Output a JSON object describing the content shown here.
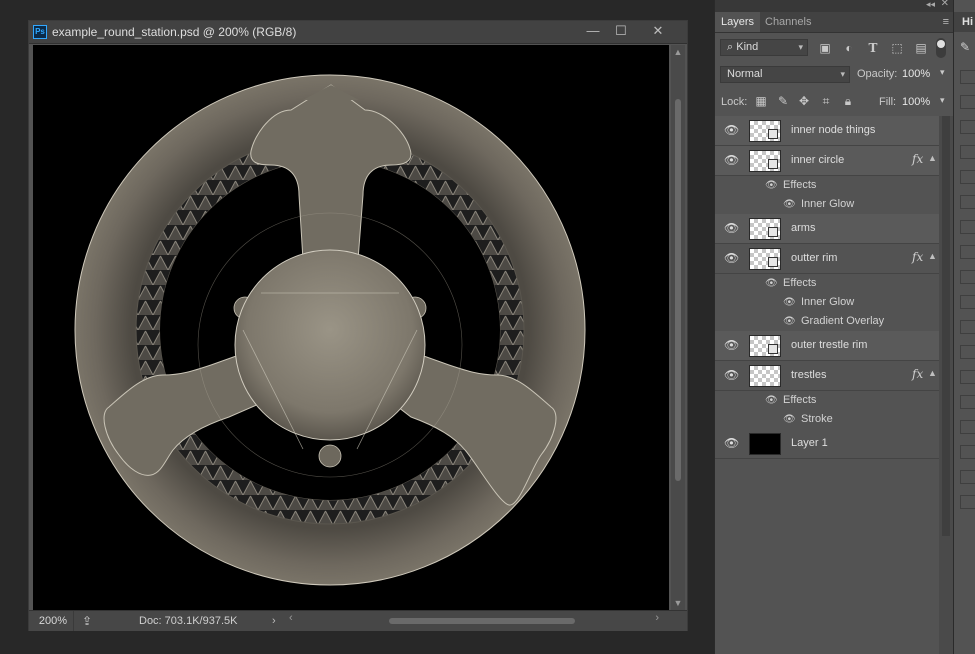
{
  "document": {
    "title": "example_round_station.psd @ 200% (RGB/8)",
    "app_icon": "Ps",
    "zoom": "200%",
    "doc_size": "Doc: 703.1K/937.5K",
    "window_controls": {
      "minimize": "—",
      "maximize": "☐",
      "close": "✕"
    }
  },
  "layers_panel": {
    "tabs": [
      "Layers",
      "Channels"
    ],
    "filter_kind": "Kind",
    "blend_mode": "Normal",
    "opacity_label": "Opacity:",
    "opacity_value": "100%",
    "lock_label": "Lock:",
    "fill_label": "Fill:",
    "fill_value": "100%",
    "fx_label": "fx",
    "effects_label": "Effects",
    "layers": [
      {
        "name": "inner node things",
        "has_fx": false,
        "thumb": "transparent"
      },
      {
        "name": "inner circle",
        "has_fx": true,
        "thumb": "transparent",
        "effects": [
          "Inner Glow"
        ]
      },
      {
        "name": "arms",
        "has_fx": false,
        "thumb": "transparent"
      },
      {
        "name": "outter rim",
        "has_fx": true,
        "thumb": "transparent",
        "effects": [
          "Inner Glow",
          "Gradient Overlay"
        ]
      },
      {
        "name": "outer trestle rim",
        "has_fx": false,
        "thumb": "transparent"
      },
      {
        "name": "trestles",
        "has_fx": true,
        "thumb": "transparent",
        "effects": [
          "Stroke"
        ]
      },
      {
        "name": "Layer 1",
        "has_fx": false,
        "thumb": "black"
      }
    ]
  },
  "history_panel": {
    "tab_label": "Hi"
  },
  "colors": {
    "canvas_bg": "#000000",
    "station_fill": "#6f6a60",
    "station_stroke": "#c9c4b6",
    "trestle_dark": "#2a2a2a",
    "ui_panel": "#535353",
    "accent_ps": "#31a8ff"
  }
}
